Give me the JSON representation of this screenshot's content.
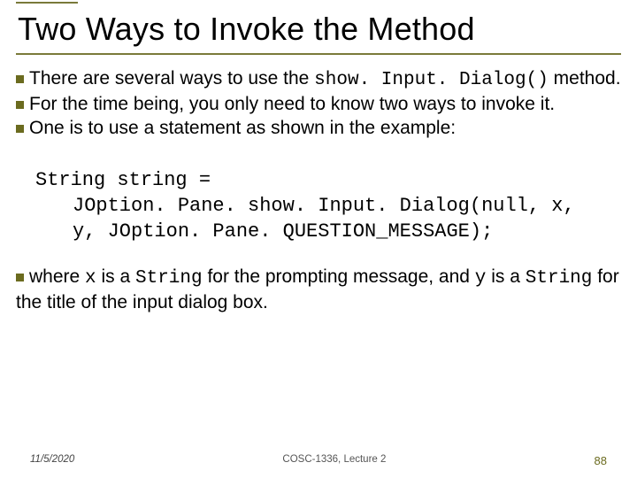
{
  "title": "Two Ways to Invoke the Method",
  "bullets": {
    "b1a": "There are several ways to use the ",
    "b1code": "show. Input. Dialog()",
    "b1b": " method.",
    "b2": "For the time being, you only need to know two ways to invoke it.",
    "b3": "One is to use a statement as shown in the example:"
  },
  "code": {
    "l1": "String string =",
    "l2": "JOption. Pane. show. Input. Dialog(null, x,",
    "l3": "y, JOption. Pane. QUESTION_MESSAGE);"
  },
  "tail": {
    "t1": "where ",
    "t1cx": "x",
    "t2": " is a ",
    "t2cs": "String",
    "t3": " for the prompting message, and ",
    "t3cy": "y",
    "t4": " is a ",
    "t4cs": "String",
    "t5": " for the title of the input dialog box."
  },
  "footer": {
    "date": "11/5/2020",
    "course": "COSC-1336, Lecture 2",
    "page": "88"
  }
}
